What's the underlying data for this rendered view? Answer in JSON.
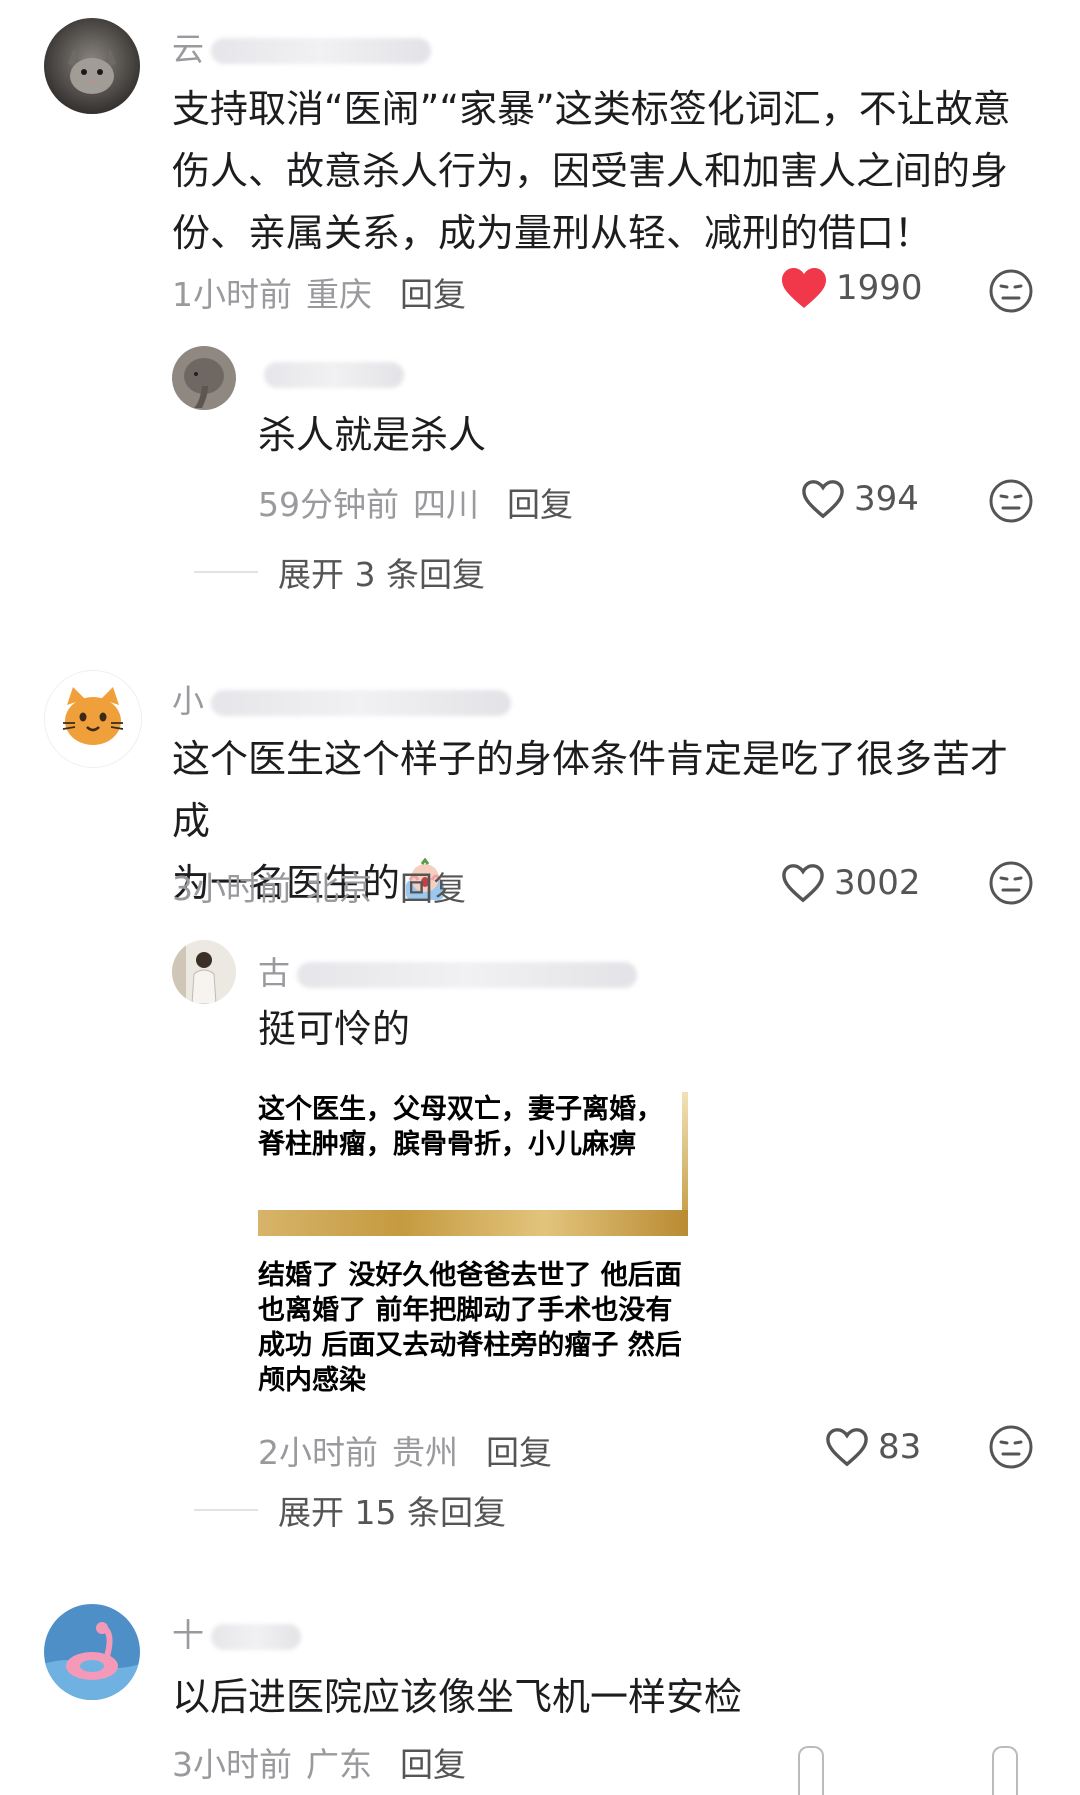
{
  "comments": [
    {
      "user_prefix": "云",
      "text": "支持取消“医闹”“家暴”这类标签化词汇，不让故意伤人、故意杀人行为，因受害人和加害人之间的身份、亲属关系，成为量刑从轻、减刑的借口！",
      "time": "1小时前",
      "location": "重庆",
      "reply_label": "回复",
      "likes": "1990",
      "liked": true,
      "replies": [
        {
          "user_prefix": "",
          "text": "杀人就是杀人",
          "time": "59分钟前",
          "location": "四川",
          "reply_label": "回复",
          "likes": "394"
        }
      ],
      "expand_label": "展开 3 条回复"
    },
    {
      "user_prefix": "小",
      "text_line1": "这个医生这个样子的身体条件肯定是吃了很多苦才成",
      "text_line2": "为一名医生的",
      "time": "3小时前",
      "location": "北京",
      "reply_label": "回复",
      "likes": "3002",
      "replies": [
        {
          "user_prefix": "古",
          "text": "挺可怜的",
          "image_caption": "这个医生，父母双亡，妻子离婚，脊柱肿瘤，膑骨骨折，小儿麻痹",
          "image_text": "结婚了 没好久他爸爸去世了 他后面也离婚了 前年把脚动了手术也没有成功 后面又去动脊柱旁的瘤子 然后颅内感染",
          "time": "2小时前",
          "location": "贵州",
          "reply_label": "回复",
          "likes": "83"
        }
      ],
      "expand_label": "展开 15 条回复"
    },
    {
      "user_prefix": "十",
      "text": "以后进医院应该像坐飞机一样安检",
      "time": "3小时前",
      "location": "广东",
      "reply_label": "回复"
    }
  ],
  "colors": {
    "liked_heart": "#f0384a",
    "meta_gray": "#9a9a9e",
    "text": "#1d1d1f"
  },
  "icons": [
    "heart-icon",
    "heart-outline-icon",
    "dislike-face-icon",
    "cat-avatar-icon",
    "screaming-emoji-icon"
  ]
}
